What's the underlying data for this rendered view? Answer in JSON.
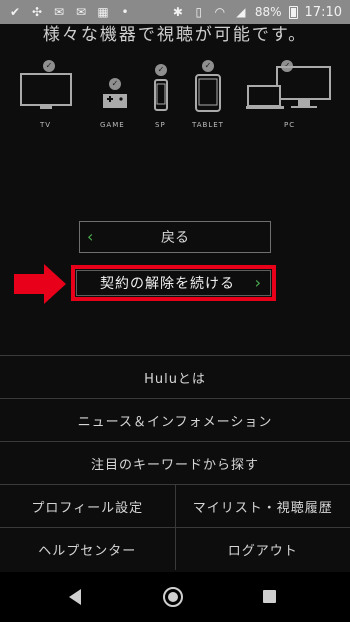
{
  "status_bar": {
    "battery_percent": "88%",
    "time": "17:10",
    "icons": [
      "check-icon",
      "fan-icon",
      "mail-icon",
      "mail-icon",
      "app-grid-icon",
      "dots-icon",
      "bluetooth-icon",
      "vibrate-icon",
      "wifi-icon",
      "signal-icon",
      "battery-icon"
    ]
  },
  "headline": "様々な機器で視聴が可能です。",
  "devices": [
    {
      "label": "TV",
      "icon": "tv-icon"
    },
    {
      "label": "GAME",
      "icon": "game-controller-icon"
    },
    {
      "label": "SP",
      "icon": "smartphone-icon"
    },
    {
      "label": "TABLET",
      "icon": "tablet-icon"
    },
    {
      "label": "PC",
      "icon": "pc-icon"
    }
  ],
  "buttons": {
    "back_label": "戻る",
    "continue_cancel_label": "契約の解除を続ける"
  },
  "menu": {
    "about": "Huluとは",
    "news": "ニュース＆インフォメーション",
    "keywords": "注目のキーワードから探す",
    "profile": "プロフィール設定",
    "mylist": "マイリスト・視聴履歴",
    "help": "ヘルプセンター",
    "logout": "ログアウト"
  },
  "colors": {
    "background": "#0d0d0d",
    "highlight_red": "#e8001a",
    "chevron_green": "#4caf50"
  }
}
